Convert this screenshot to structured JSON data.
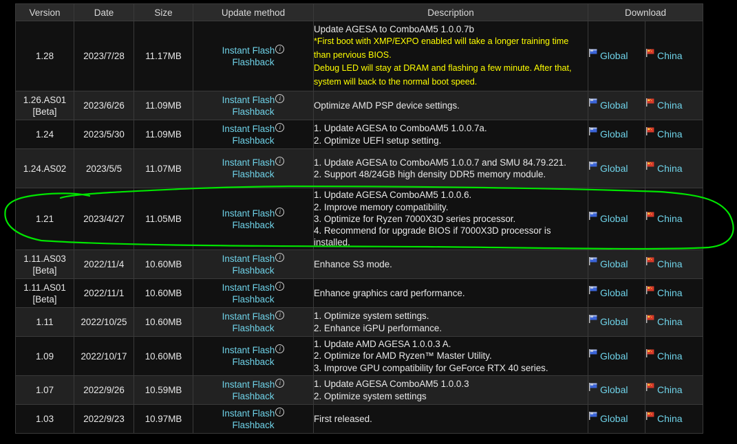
{
  "headers": [
    "Version",
    "Date",
    "Size",
    "Update method",
    "Description",
    "Download"
  ],
  "update_method": {
    "instant_flash": "Instant Flash",
    "flashback": "Flashback",
    "info_glyph": "i"
  },
  "download": {
    "global_label": "Global",
    "china_label": "China",
    "global_icon": "global-flag-icon",
    "china_icon": "china-flag-icon"
  },
  "colors": {
    "link": "#6fd3e9",
    "warning": "#ffff00",
    "annotation": "#00e600"
  },
  "rows": [
    {
      "version": "1.28",
      "date": "2023/7/28",
      "size": "11.17MB",
      "desc": [
        {
          "text": "Update AGESA to ComboAM5 1.0.0.7b",
          "style": "normal"
        },
        {
          "text": "*First boot with XMP/EXPO enabled will take a longer training time than pervious BIOS.",
          "style": "warn"
        },
        {
          "text": "Debug LED will stay at DRAM and flashing a few minute. After that, system will back to the normal boot speed.",
          "style": "warn"
        }
      ]
    },
    {
      "version": "1.26.AS01",
      "beta": "[Beta]",
      "date": "2023/6/26",
      "size": "11.09MB",
      "desc": [
        {
          "text": "Optimize AMD PSP device settings.",
          "style": "normal"
        }
      ]
    },
    {
      "version": "1.24",
      "date": "2023/5/30",
      "size": "11.09MB",
      "desc": [
        {
          "text": "1. Update AGESA to ComboAM5 1.0.0.7a.",
          "style": "normal"
        },
        {
          "text": "2. Optimize UEFI setup setting.",
          "style": "normal"
        }
      ]
    },
    {
      "version": "1.24.AS02",
      "date": "2023/5/5",
      "size": "11.07MB",
      "desc": [
        {
          "text": "1. Update AGESA to ComboAM5 1.0.0.7 and SMU 84.79.221.",
          "style": "normal"
        },
        {
          "text": "2. Support 48/24GB high density DDR5 memory module.",
          "style": "normal"
        }
      ]
    },
    {
      "version": "1.21",
      "date": "2023/4/27",
      "size": "11.05MB",
      "desc": [
        {
          "text": "1. Update AGESA ComboAM5 1.0.0.6.",
          "style": "normal"
        },
        {
          "text": "2. Improve memory compatibility.",
          "style": "normal"
        },
        {
          "text": "3. Optimize for Ryzen 7000X3D series processor.",
          "style": "normal"
        },
        {
          "text": "4. Recommend for upgrade BIOS if 7000X3D processor is installed.",
          "style": "normal"
        }
      ]
    },
    {
      "version": "1.11.AS03",
      "beta": "[Beta]",
      "date": "2022/11/4",
      "size": "10.60MB",
      "desc": [
        {
          "text": "Enhance S3 mode.",
          "style": "normal"
        }
      ]
    },
    {
      "version": "1.11.AS01",
      "beta": "[Beta]",
      "date": "2022/11/1",
      "size": "10.60MB",
      "desc": [
        {
          "text": "Enhance graphics card performance.",
          "style": "normal"
        }
      ]
    },
    {
      "version": "1.11",
      "date": "2022/10/25",
      "size": "10.60MB",
      "desc": [
        {
          "text": "1. Optimize system settings.",
          "style": "normal"
        },
        {
          "text": "2. Enhance iGPU performance.",
          "style": "normal"
        }
      ]
    },
    {
      "version": "1.09",
      "date": "2022/10/17",
      "size": "10.60MB",
      "desc": [
        {
          "text": "1. Update AMD AGESA 1.0.0.3 A.",
          "style": "normal"
        },
        {
          "text": "2. Optimize for AMD Ryzen™ Master Utility.",
          "style": "normal"
        },
        {
          "text": "3. Improve GPU compatibility for GeForce RTX 40 series.",
          "style": "normal"
        }
      ]
    },
    {
      "version": "1.07",
      "date": "2022/9/26",
      "size": "10.59MB",
      "desc": [
        {
          "text": "1. Update AGESA ComboAM5 1.0.0.3",
          "style": "normal"
        },
        {
          "text": "2. Optimize system settings",
          "style": "normal"
        }
      ]
    },
    {
      "version": "1.03",
      "date": "2022/9/23",
      "size": "10.97MB",
      "desc": [
        {
          "text": "First released.",
          "style": "normal"
        }
      ]
    }
  ]
}
